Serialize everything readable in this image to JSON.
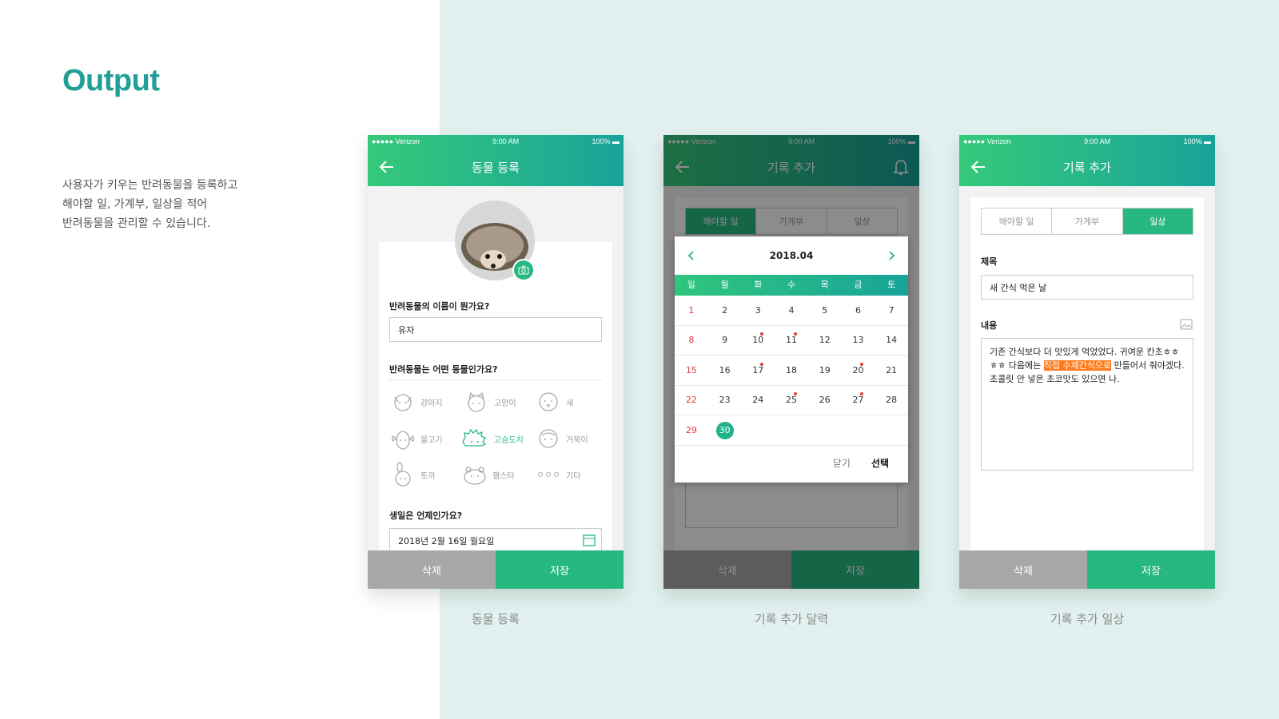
{
  "page": {
    "title": "Output",
    "description": [
      "사용자가 키우는 반려동물을 등록하고",
      "해야할 일, 가계부, 일상을 적어",
      "반려동물을 관리할 수 있습니다."
    ]
  },
  "status": {
    "carrier": "●●●●● Verizon",
    "time": "9:00 AM",
    "battery": "100%"
  },
  "screen1": {
    "caption": "동물 등록",
    "title": "동물 등록",
    "name_question": "반려동물의 이름이 뭔가요?",
    "name_value": "유자",
    "type_question": "반려동물는 어떤 동물인가요?",
    "animals": [
      {
        "label": "강아지",
        "icon": "dog-icon"
      },
      {
        "label": "고양이",
        "icon": "cat-icon"
      },
      {
        "label": "새",
        "icon": "bird-icon"
      },
      {
        "label": "물고기",
        "icon": "fish-icon"
      },
      {
        "label": "고슴도치",
        "icon": "hedgehog-icon",
        "selected": true
      },
      {
        "label": "거북이",
        "icon": "turtle-icon"
      },
      {
        "label": "토끼",
        "icon": "rabbit-icon"
      },
      {
        "label": "햄스터",
        "icon": "hamster-icon"
      },
      {
        "label": "기타",
        "icon": "more-icon"
      }
    ],
    "birthday_question": "생일은 언제인가요?",
    "birthday_value": "2018년 2월 16일 월요일",
    "delete": "삭제",
    "save": "저장"
  },
  "screen2": {
    "caption": "기록 추가 달력",
    "title": "기록 추가",
    "tabs": [
      "해야할 일",
      "가계부",
      "일상"
    ],
    "month": "2018.04",
    "weekdays": [
      "일",
      "월",
      "화",
      "수",
      "목",
      "금",
      "토"
    ],
    "weeks": [
      [
        "1",
        "2",
        "3",
        "4",
        "5",
        "6",
        "7"
      ],
      [
        "8",
        "9",
        "10",
        "11",
        "12",
        "13",
        "14"
      ],
      [
        "15",
        "16",
        "17",
        "18",
        "19",
        "20",
        "21"
      ],
      [
        "22",
        "23",
        "24",
        "25",
        "26",
        "27",
        "28"
      ],
      [
        "29",
        "30",
        "",
        "",
        "",
        "",
        ""
      ]
    ],
    "dotted_days": [
      "10",
      "11",
      "17",
      "20",
      "25",
      "27"
    ],
    "selected_day": "30",
    "close": "닫기",
    "select": "선택",
    "delete": "삭제",
    "save": "저장"
  },
  "screen3": {
    "caption": "기록 추가 일상",
    "title": "기록 추가",
    "tabs": [
      "해야할 일",
      "가계부",
      "일상"
    ],
    "active_tab": "일상",
    "title_label": "제목",
    "title_value": "새 간식 먹은 날",
    "content_label": "내용",
    "content_before": "기존 간식보다 더 맛있게 먹었었다. 귀여운 칸초ㅎㅎㅎㅎ 다음에는 ",
    "content_highlight": "직접 수제간식으로",
    "content_after": " 만들어서 줘야겠다. 초콜릿 안 넣은 초코맛도 있으면 나.",
    "delete": "삭제",
    "save": "저장"
  },
  "colors": {
    "accent": "#27b882",
    "title": "#1f9f95",
    "highlight": "#ff7a1a",
    "weekend": "#e23b3b"
  }
}
